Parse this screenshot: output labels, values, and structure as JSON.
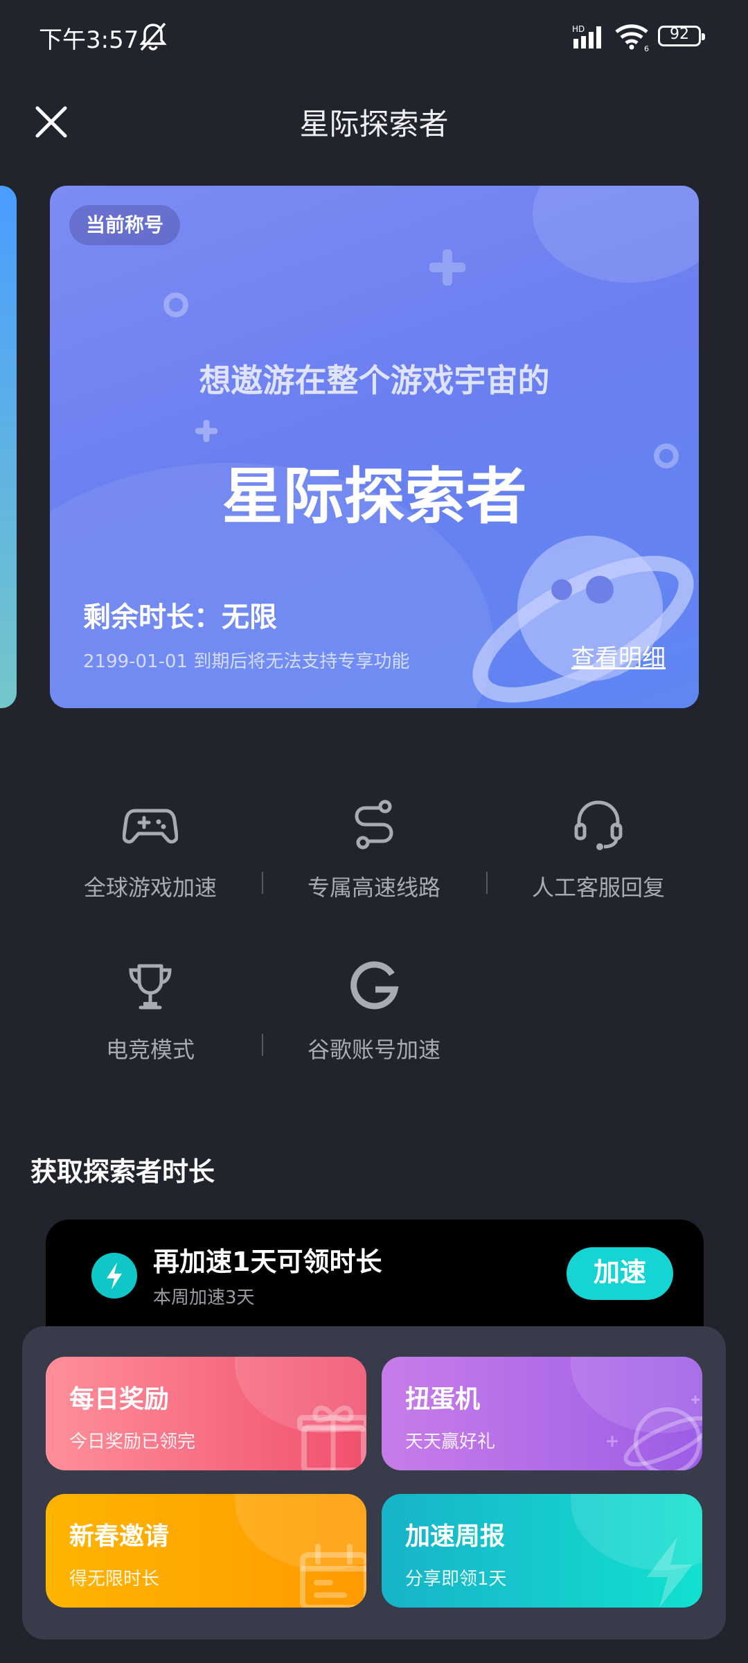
{
  "status_bar": {
    "time": "下午3:57",
    "network": "HD",
    "sim": "6",
    "battery": "92"
  },
  "header": {
    "title": "星际探索者"
  },
  "title_card": {
    "badge": "当前称号",
    "subtitle": "想遨游在整个游戏宇宙的",
    "name": "星际探索者",
    "remaining": "剩余时长：无限",
    "expire_note": "2199-01-01 到期后将无法支持专享功能",
    "detail_link": "查看明细"
  },
  "features": [
    {
      "label": "全球游戏加速",
      "icon": "gamepad-icon"
    },
    {
      "label": "专属高速线路",
      "icon": "route-icon"
    },
    {
      "label": "人工客服回复",
      "icon": "headset-icon"
    },
    {
      "label": "电竞模式",
      "icon": "trophy-icon"
    },
    {
      "label": "谷歌账号加速",
      "icon": "google-icon"
    }
  ],
  "section": {
    "title": "获取探索者时长"
  },
  "accelerate_task": {
    "title": "再加速1天可领时长",
    "subtitle": "本周加速3天",
    "button": "加速"
  },
  "tiles": [
    {
      "title": "每日奖励",
      "subtitle": "今日奖励已领完",
      "icon": "gift-icon",
      "color_start": "#ff8f9a",
      "color_end": "#f0506e"
    },
    {
      "title": "扭蛋机",
      "subtitle": "天天赢好礼",
      "icon": "planet-icon",
      "color_start": "#c77de8",
      "color_end": "#9d5ce6"
    },
    {
      "title": "新春邀请",
      "subtitle": "得无限时长",
      "icon": "calendar-icon",
      "color_start": "#ffb400",
      "color_end": "#ff9a00"
    },
    {
      "title": "加速周报",
      "subtitle": "分享即领1天",
      "icon": "bolt-icon",
      "color_start": "#18b3c9",
      "color_end": "#12e0cf"
    }
  ],
  "colors": {
    "background": "#22242d",
    "accent": "#16d4d4",
    "card": "#6b7ff0"
  }
}
